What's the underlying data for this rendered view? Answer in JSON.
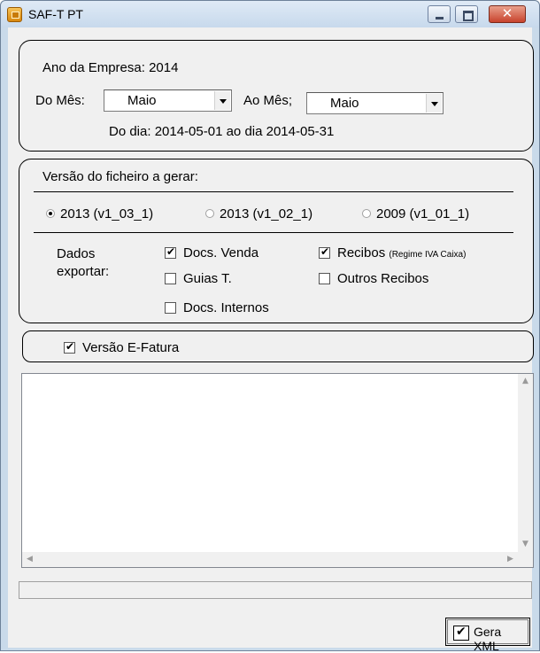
{
  "window": {
    "title": "SAF-T PT",
    "close_glyph": "✕"
  },
  "period": {
    "ano_label": "Ano da Empresa:",
    "ano_value": "2014",
    "do_mes_label": "Do Mês:",
    "do_mes_value": "Maio",
    "ao_mes_label": "Ao Mês;",
    "ao_mes_value": "Maio",
    "range_text": "Do dia: 2014-05-01 ao dia 2014-05-31"
  },
  "versao": {
    "heading": "Versão do ficheiro a gerar:",
    "options": [
      {
        "label": "2013 (v1_03_1)",
        "selected": true
      },
      {
        "label": "2013 (v1_02_1)",
        "selected": false
      },
      {
        "label": "2009 (v1_01_1)",
        "selected": false
      }
    ]
  },
  "dados": {
    "label_line1": "Dados",
    "label_line2": "exportar:",
    "docs_venda": {
      "label": "Docs. Venda",
      "checked": true
    },
    "recibos": {
      "label": "Recibos",
      "note": "(Regime IVA Caixa)",
      "checked": true
    },
    "guias": {
      "label": "Guias T.",
      "checked": false
    },
    "outros_recibos": {
      "label": "Outros Recibos",
      "checked": false
    },
    "docs_internos": {
      "label": "Docs. Internos",
      "checked": false
    }
  },
  "efatura": {
    "label": "Versão E-Fatura",
    "checked": true
  },
  "scroll": {
    "up": "▲",
    "down": "▼",
    "left": "◀",
    "right": "▶"
  },
  "actions": {
    "gera_label": "Gera XML"
  }
}
